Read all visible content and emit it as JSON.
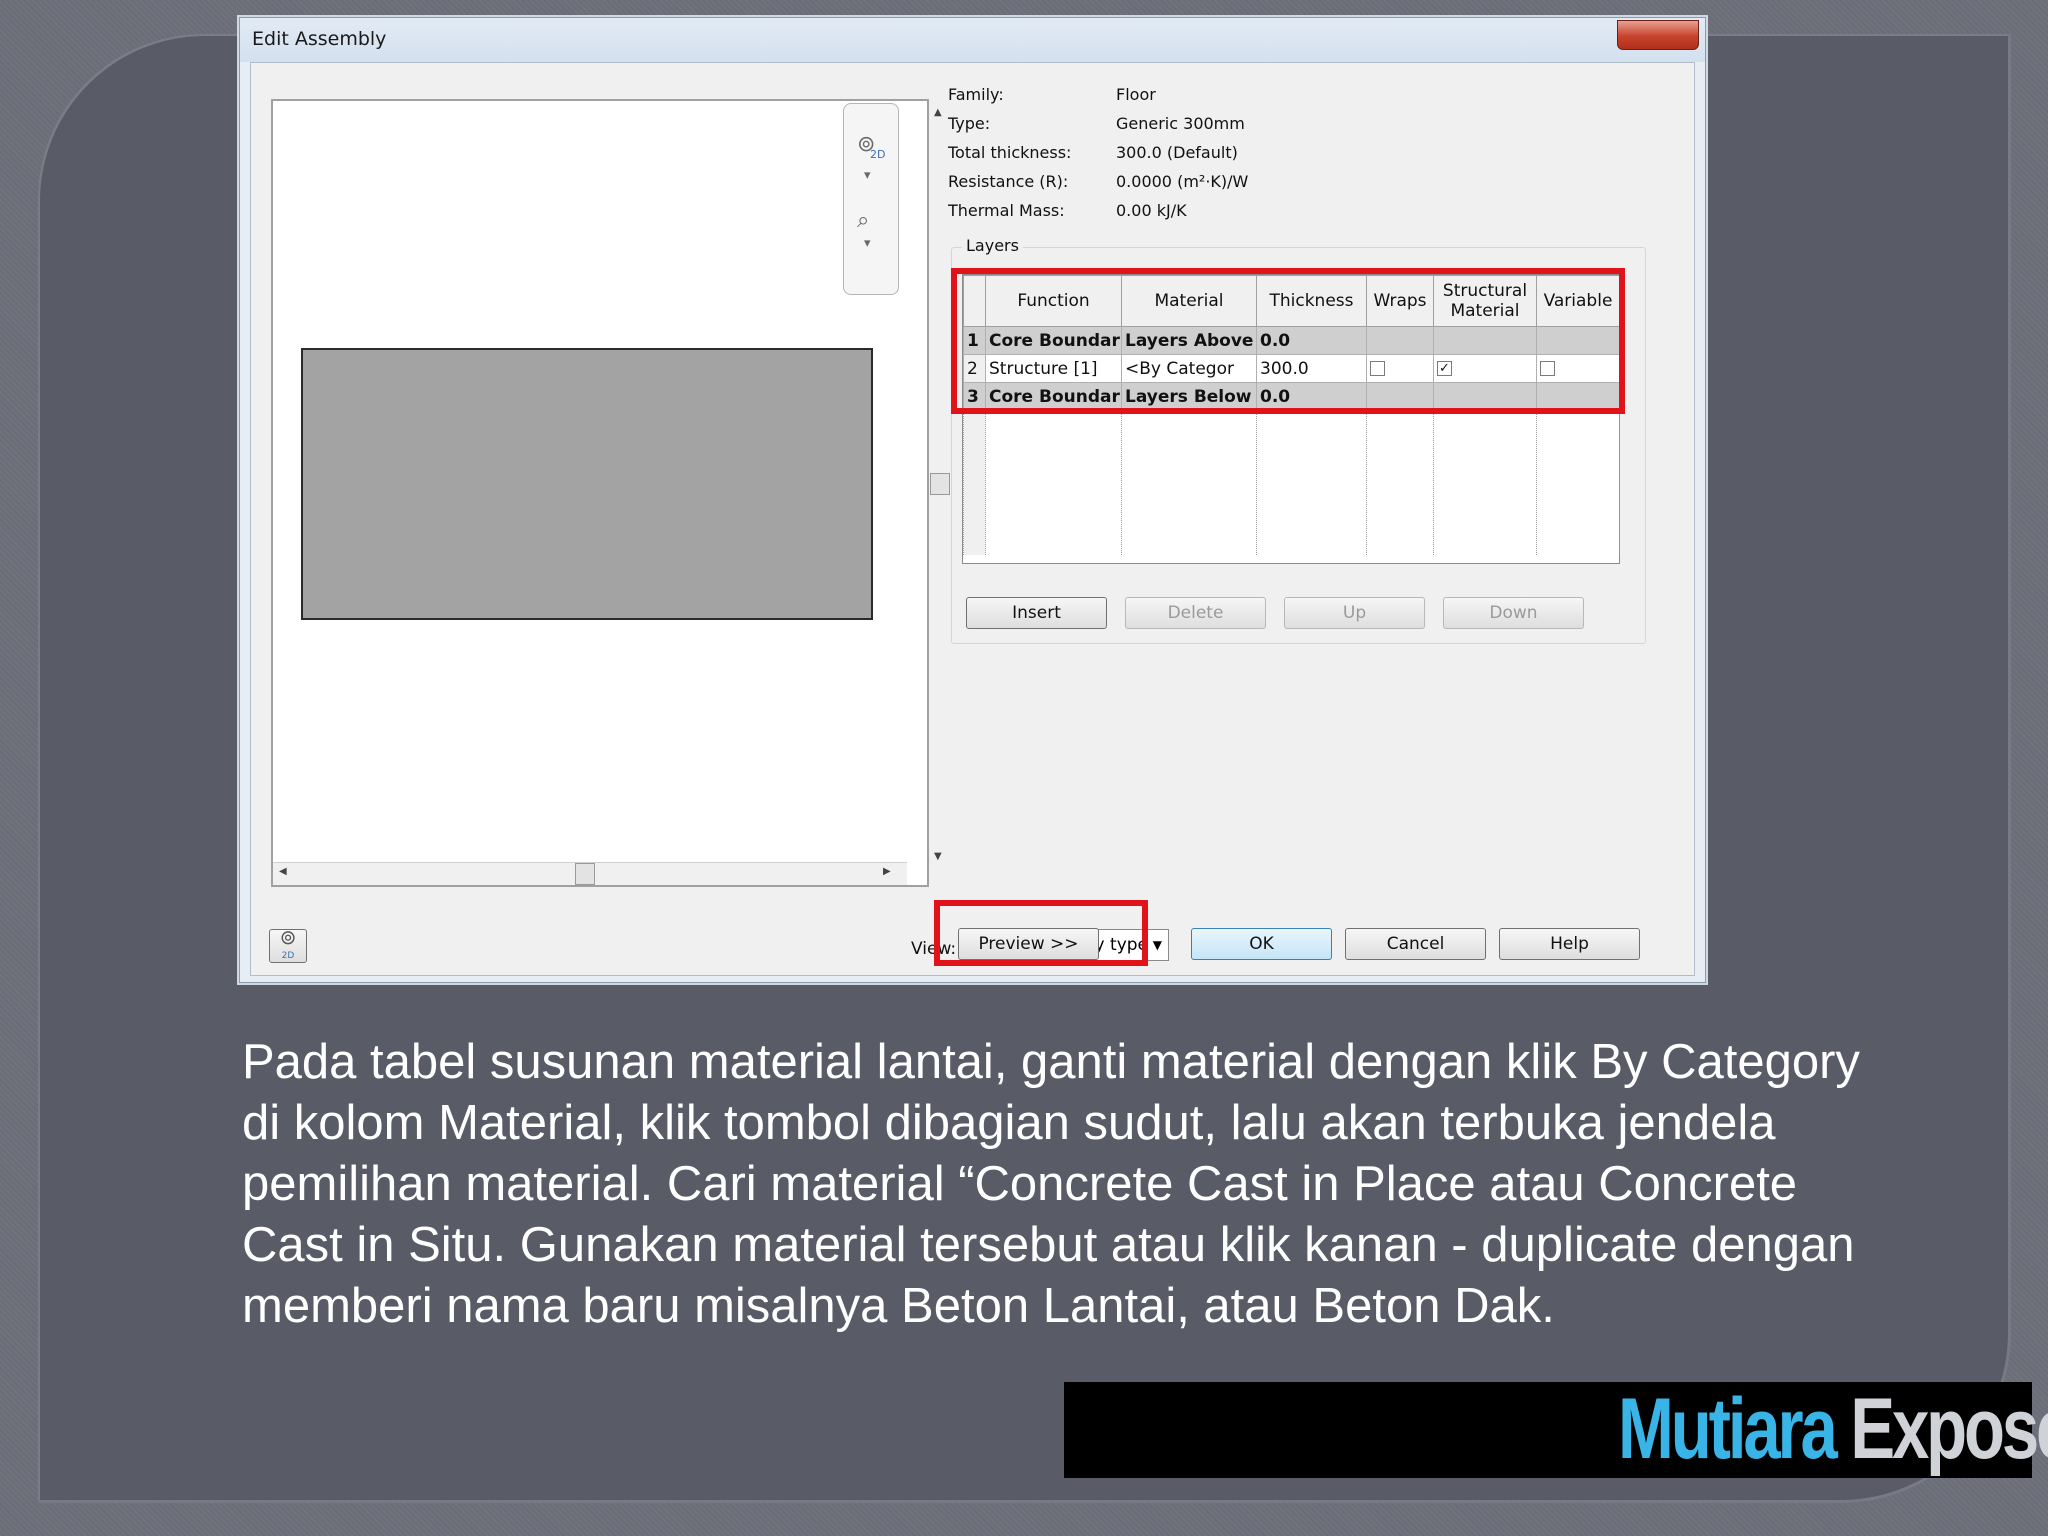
{
  "dialog": {
    "title": "Edit Assembly",
    "close_glyph": "✕"
  },
  "properties": [
    {
      "label": "Family:",
      "value": "Floor"
    },
    {
      "label": "Type:",
      "value": "Generic 300mm"
    },
    {
      "label": "Total thickness:",
      "value": "300.0 (Default)"
    },
    {
      "label": "Resistance (R):",
      "value": "0.0000 (m²·K)/W"
    },
    {
      "label": "Thermal Mass:",
      "value": "0.00 kJ/K"
    }
  ],
  "layers": {
    "group_label": "Layers",
    "columns": [
      "Function",
      "Material",
      "Thickness",
      "Wraps",
      "Structural Material",
      "Variable"
    ],
    "rows": [
      {
        "num": "1",
        "function": "Core Boundar",
        "material": "Layers Above",
        "thickness": "0.0"
      },
      {
        "num": "2",
        "function": "Structure [1]",
        "material": "<By Categor",
        "thickness": "300.0",
        "wraps": false,
        "structural": true,
        "variable": false
      },
      {
        "num": "3",
        "function": "Core Boundar",
        "material": "Layers Below",
        "thickness": "0.0"
      }
    ],
    "buttons": {
      "insert": "Insert",
      "delete": "Delete",
      "up": "Up",
      "down": "Down"
    }
  },
  "footer": {
    "view_label": "View:",
    "view_value": "Section: Modify type",
    "preview": "Preview >>",
    "ok": "OK",
    "cancel": "Cancel",
    "help": "Help"
  },
  "icons": {
    "nav_wheel": "⊚",
    "zoom": "⌕",
    "down": "▾",
    "up_arrow": "▲",
    "down_arrow": "▼",
    "left_arrow": "◀",
    "right_arrow": "▶",
    "check": "✓",
    "select_arrow": "▼",
    "wheel_2d": "2D"
  },
  "caption": "Pada tabel susunan material lantai, ganti material dengan klik By Category di kolom Material, klik tombol dibagian sudut, lalu akan terbuka jendela pemilihan material. Cari material “Concrete Cast in Place atau Concrete Cast in Situ. Gunakan material tersebut atau klik kanan - duplicate dengan memberi nama baru misalnya Beton Lantai, atau Beton Dak.",
  "logo": {
    "part1": "Mutiara",
    "part2": "Expose"
  },
  "colors": {
    "highlight": "#e0131b",
    "logo_blue": "#39b4e6",
    "background": "#6a6c77"
  }
}
